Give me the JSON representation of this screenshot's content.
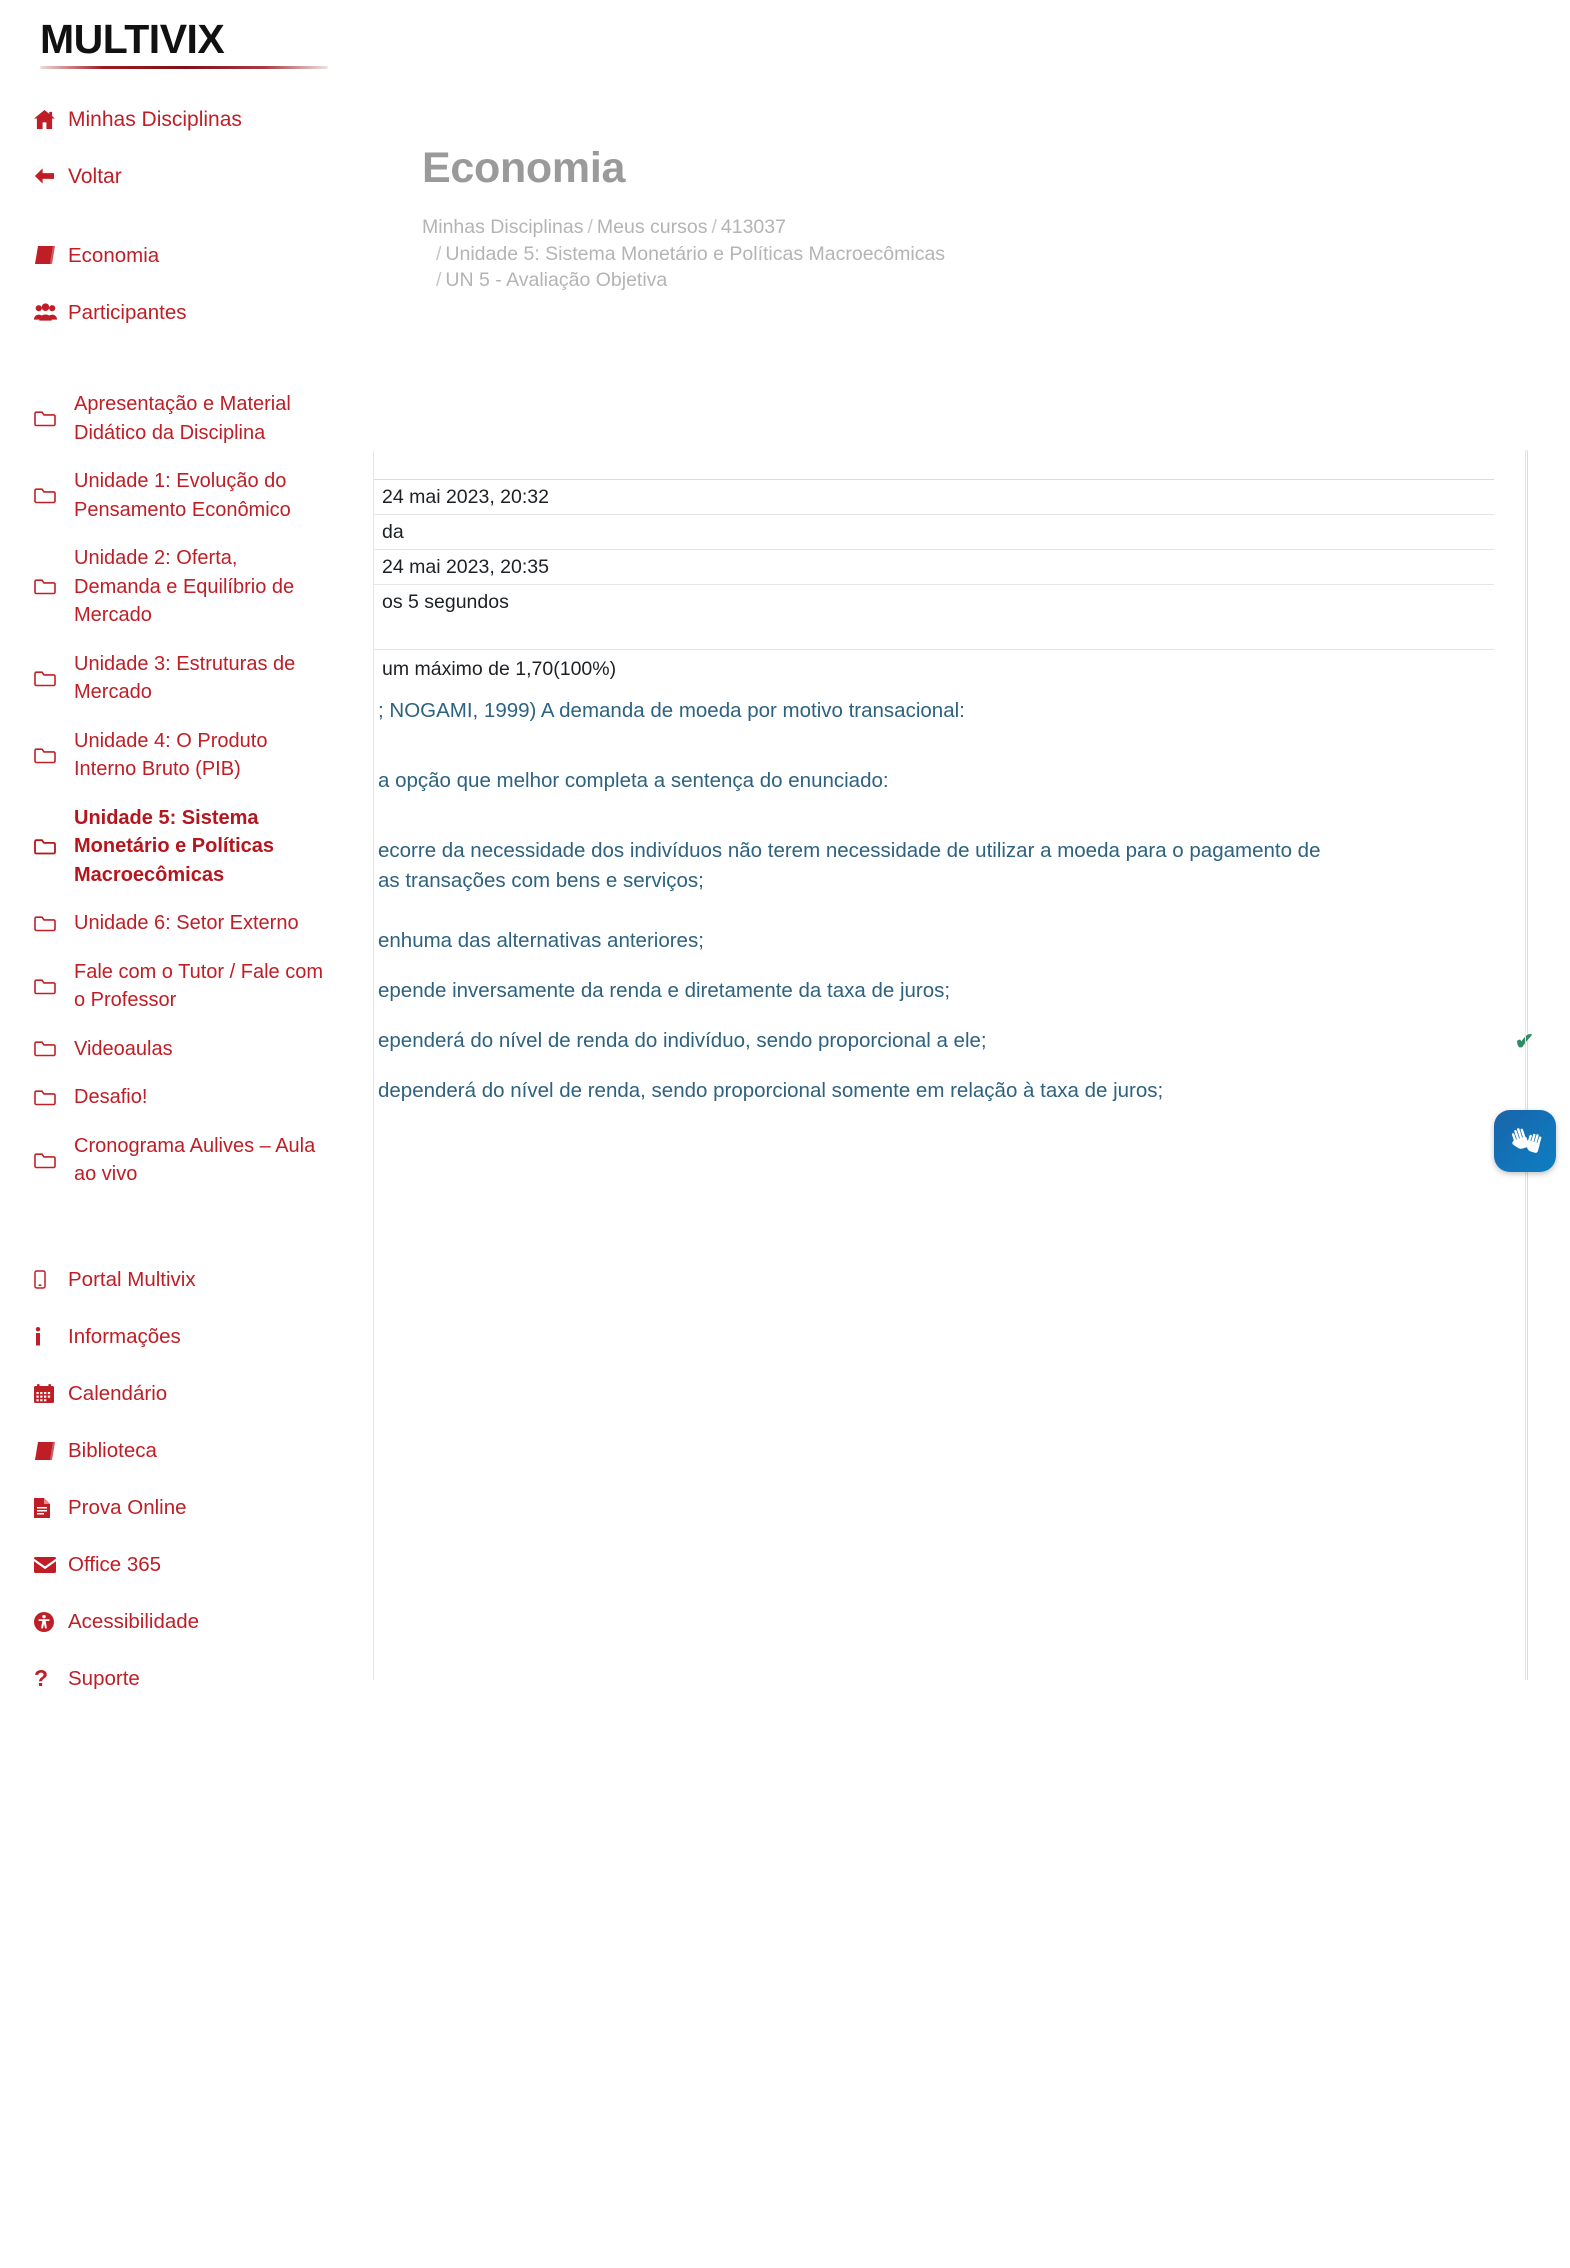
{
  "brand": {
    "name": "MULTIVIX"
  },
  "sidebar": {
    "top_items": [
      {
        "label": "Minhas Disciplinas",
        "icon": "home-icon"
      },
      {
        "label": "Voltar",
        "icon": "arrow-left-icon"
      }
    ],
    "course_items": [
      {
        "label": "Economia",
        "icon": "book-icon"
      },
      {
        "label": "Participantes",
        "icon": "users-icon"
      }
    ],
    "unit_items": [
      {
        "label": "Apresentação e Material Didático da Disciplina",
        "icon": "folder-icon",
        "active": false
      },
      {
        "label": "Unidade 1: Evolução do Pensamento Econômico",
        "icon": "folder-icon",
        "active": false
      },
      {
        "label": "Unidade 2: Oferta, Demanda e Equilíbrio de Mercado",
        "icon": "folder-icon",
        "active": false
      },
      {
        "label": "Unidade 3: Estruturas de Mercado",
        "icon": "folder-icon",
        "active": false
      },
      {
        "label": "Unidade 4: O Produto Interno Bruto (PIB)",
        "icon": "folder-icon",
        "active": false
      },
      {
        "label": "Unidade 5: Sistema Monetário e Políticas Macroecômicas",
        "icon": "folder-icon",
        "active": true
      },
      {
        "label": "Unidade 6: Setor Externo",
        "icon": "folder-icon",
        "active": false
      },
      {
        "label": "Fale com o Tutor / Fale com o Professor",
        "icon": "folder-icon",
        "active": false
      },
      {
        "label": "Videoaulas",
        "icon": "folder-icon",
        "active": false
      },
      {
        "label": "Desafio!",
        "icon": "folder-icon",
        "active": false
      },
      {
        "label": "Cronograma Aulives – Aula ao vivo",
        "icon": "folder-icon",
        "active": false
      }
    ],
    "footer_items": [
      {
        "label": "Portal Multivix",
        "icon": "mobile-icon"
      },
      {
        "label": "Informações",
        "icon": "info-icon"
      },
      {
        "label": "Calendário",
        "icon": "calendar-icon"
      },
      {
        "label": "Biblioteca",
        "icon": "book-icon"
      },
      {
        "label": "Prova Online",
        "icon": "file-document-icon"
      },
      {
        "label": "Office 365",
        "icon": "envelope-icon"
      },
      {
        "label": "Acessibilidade",
        "icon": "accessibility-icon"
      },
      {
        "label": "Suporte",
        "icon": "question-mark-icon"
      }
    ]
  },
  "header": {
    "title": "Economia",
    "breadcrumb": {
      "l1_a": "Minhas Disciplinas",
      "l1_b": "Meus cursos",
      "l1_c": "413037",
      "l2": "Unidade 5: Sistema Monetário e Políticas Macroecômicas",
      "l3": "UN 5 - Avaliação Objetiva",
      "separator": "/"
    }
  },
  "attempt_summary": {
    "rows": [
      {
        "value": "24 mai 2023, 20:32"
      },
      {
        "value": "da"
      },
      {
        "value": "24 mai 2023, 20:35"
      },
      {
        "value": "os 5 segundos"
      }
    ],
    "grade": "um máximo de 1,70(100%)"
  },
  "question": {
    "stem": "; NOGAMI, 1999) A demanda de moeda por motivo transacional:",
    "instruction": "a opção que melhor completa a sentença do enunciado:",
    "options": [
      {
        "text": "ecorre da necessidade dos indivíduos não terem necessidade de utilizar a moeda para o pagamento de",
        "text2": "as transações com bens e serviços;",
        "correct": false
      },
      {
        "text": "enhuma das alternativas anteriores;",
        "text2": "",
        "correct": false
      },
      {
        "text": "epende inversamente da renda e diretamente da taxa de juros;",
        "text2": "",
        "correct": false
      },
      {
        "text": "ependerá do nível de renda do indivíduo, sendo proporcional a ele;",
        "text2": "",
        "correct": true
      },
      {
        "text": "dependerá do nível de renda, sendo proporcional somente em relação à taxa de juros;",
        "text2": "",
        "correct": false
      }
    ],
    "correct_mark": "✔"
  },
  "widgets": {
    "vlibras_label": "VLibras"
  },
  "colors": {
    "brand_red": "#bf1e26",
    "title_grey": "#9a9a9a",
    "body_blue": "#2d6280",
    "correct_green": "#2e8b63",
    "vlibras_blue": "#1273b8"
  }
}
